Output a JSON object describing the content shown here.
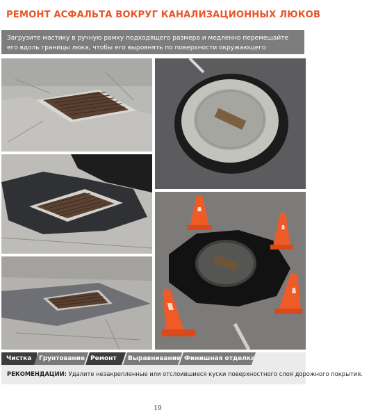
{
  "header": {
    "title": "РЕМОНТ АСФАЛЬТА ВОКРУГ КАНАЛИЗАЦИОННЫХ ЛЮКОВ",
    "title_color": "#e8562a"
  },
  "intro": {
    "text": "Загрузите мастику в ручную рамку подходящего размера и медленно перемещайте его вдоль границы люка, чтобы его выровнять по поверхности окружающего дорожного покрытия."
  },
  "photos": [
    {
      "id": "p1",
      "subject": "rectangular grate in cracked asphalt"
    },
    {
      "id": "p2",
      "subject": "rectangular grate with fresh asphalt patch"
    },
    {
      "id": "p3",
      "subject": "rectangular grate on grey mat"
    },
    {
      "id": "p4",
      "subject": "round manhole cover with black rubber ring"
    },
    {
      "id": "p5",
      "subject": "manhole with black sealant and four traffic cones"
    }
  ],
  "steps": [
    "Чистка",
    "Грунтование",
    "Ремонт",
    "Выравнивание",
    "Финишная отделка"
  ],
  "active_step_colors": {
    "dark": "#3c3c3c",
    "mid": "#7a7a7a"
  },
  "recommendation": {
    "label": "РЕКОМЕНДАЦИИ:",
    "text": "Удалите незакрепленные или отслоившиеся куски поверхностного слоя дорожного покрытия."
  },
  "page_number": "19"
}
